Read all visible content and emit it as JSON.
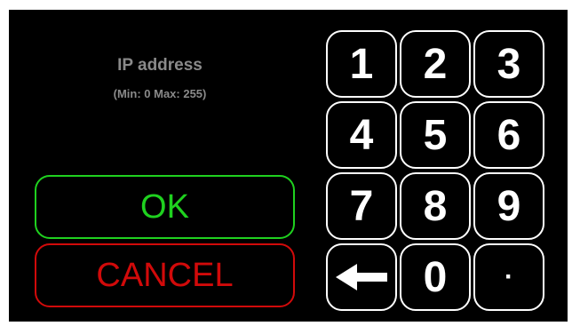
{
  "prompt": {
    "title": "IP address",
    "range": "(Min: 0  Max: 255)"
  },
  "actions": {
    "ok_label": "OK",
    "cancel_label": "CANCEL",
    "ok_color": "#1fd11f",
    "cancel_color": "#d10a0a"
  },
  "keypad": {
    "k1": "1",
    "k2": "2",
    "k3": "3",
    "k4": "4",
    "k5": "5",
    "k6": "6",
    "k7": "7",
    "k8": "8",
    "k9": "9",
    "k0": "0",
    "dot": "·",
    "backspace_icon": "arrow-left-icon"
  }
}
